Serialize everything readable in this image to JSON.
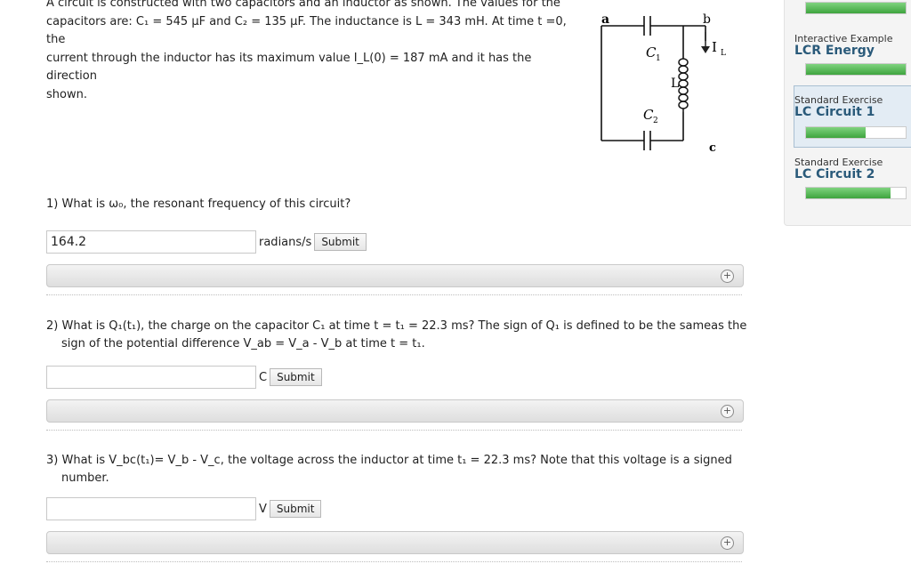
{
  "problem": {
    "intro_line1": "A circuit is constructed with two capacitors and an inductor as shown. The values for the",
    "intro_line2": "capacitors are: C₁ = 545 μF and C₂ = 135 μF. The inductance is L = 343 mH. At time t =0, the",
    "intro_line3": "current through the inductor has its maximum value I_L(0) = 187 mA and it has the direction",
    "intro_line4": "shown."
  },
  "circuit": {
    "label_a": "a",
    "label_b": "b",
    "label_c": "c",
    "label_c1": "C",
    "label_c1_sub": "1",
    "label_c2": "C",
    "label_c2_sub": "2",
    "label_L": "L",
    "label_IL": "I",
    "label_IL_sub": "L"
  },
  "questions": [
    {
      "text": "1) What is ω₀, the resonant frequency of this circuit?",
      "value": "164.2",
      "unit": "radians/s",
      "submit": "Submit"
    },
    {
      "line1": "2) What is Q₁(t₁), the charge on the capacitor C₁ at time t = t₁ = 22.3 ms? The sign of Q₁ is defined to be the sameas the",
      "line2": "sign of the potential difference V_ab = V_a - V_b at time t = t₁.",
      "value": "",
      "unit": "C",
      "submit": "Submit"
    },
    {
      "line1": "3) What is V_bc(t₁)= V_b - V_c, the voltage across the inductor at time t₁ = 22.3 ms? Note that this voltage is a signed",
      "line2": "number.",
      "value": "",
      "unit": "V",
      "submit": "Submit"
    }
  ],
  "hint_icon": "plus-circle",
  "sidebar": {
    "items": [
      {
        "kind": "Interactive Example",
        "title": "LCR Energy",
        "progress": 1.0
      },
      {
        "kind": "Standard Exercise",
        "title": "LC Circuit 1",
        "progress": 0.6
      },
      {
        "kind": "Standard Exercise",
        "title": "LC Circuit 2",
        "progress": 0.85
      }
    ],
    "top_progress": 1.0
  },
  "colors": {
    "accent": "#2a5a7a",
    "progress": "#3ea43e"
  }
}
